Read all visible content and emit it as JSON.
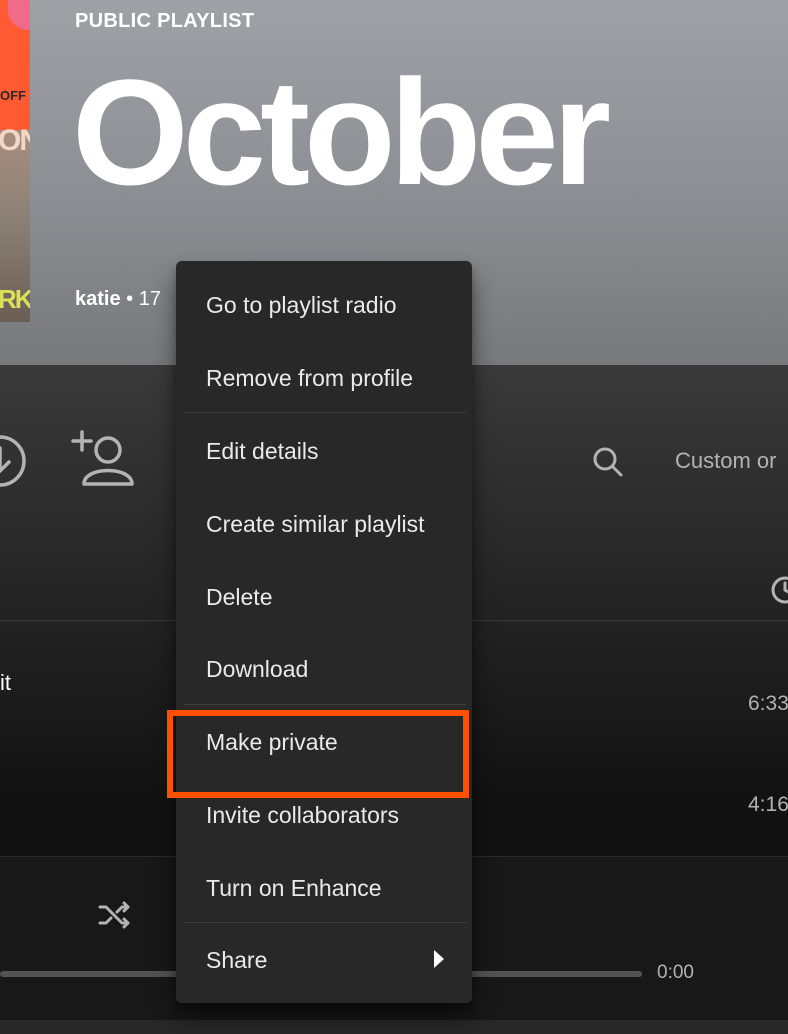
{
  "header": {
    "type_label": "PUBLIC PLAYLIST",
    "title": "October",
    "owner": "katie",
    "meta_fragment": " • 17"
  },
  "cover_art": {
    "text_top": "OFF",
    "text_mid": "ON",
    "text_bottom": "RK"
  },
  "actions": {
    "sort_label": "Custom or"
  },
  "tracks": [
    {
      "title_fragment": "it",
      "duration": "6:33"
    },
    {
      "title_fragment": "",
      "duration": "4:16"
    }
  ],
  "player": {
    "time_end": "0:00"
  },
  "context_menu": {
    "items": [
      {
        "label": "Go to playlist radio"
      },
      {
        "label": "Remove from profile"
      },
      {
        "label": "Edit details"
      },
      {
        "label": "Create similar playlist"
      },
      {
        "label": "Delete"
      },
      {
        "label": "Download"
      },
      {
        "label": "Make private"
      },
      {
        "label": "Invite collaborators"
      },
      {
        "label": "Turn on Enhance"
      },
      {
        "label": "Share"
      }
    ],
    "highlighted_item": "Make private"
  },
  "colors": {
    "highlight": "#ff4f00",
    "menu_bg": "#282828"
  }
}
